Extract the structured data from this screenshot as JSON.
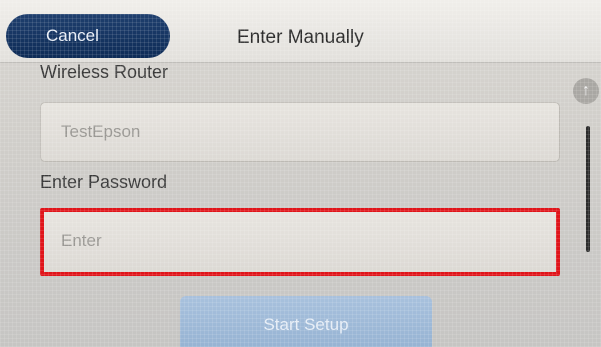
{
  "header": {
    "cancel_label": "Cancel",
    "title": "Enter Manually"
  },
  "form": {
    "router_label": "Wireless Router",
    "router_value": "TestEpson",
    "password_label": "Enter Password",
    "password_placeholder": "Enter"
  },
  "actions": {
    "start_setup_label": "Start Setup"
  },
  "scroll": {
    "up_icon": "↑"
  },
  "colors": {
    "highlight": "#e0141a",
    "cancel_button": "#0e2c57",
    "start_button": "#9db8d7"
  }
}
